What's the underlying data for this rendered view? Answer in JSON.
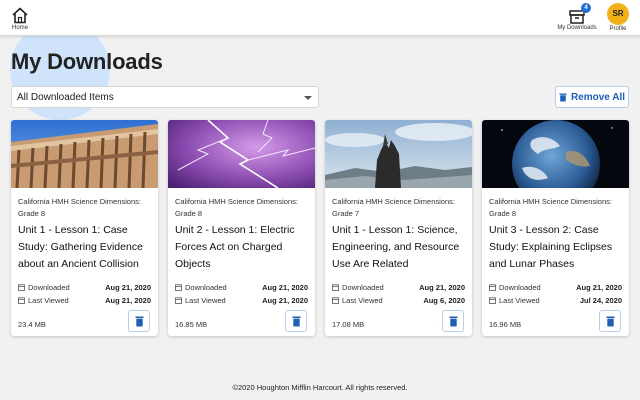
{
  "header": {
    "home_label": "Home",
    "downloads_label": "My Downloads",
    "downloads_badge": "4",
    "profile_initials": "SR",
    "profile_label": "Profile"
  },
  "page": {
    "title": "My Downloads",
    "filter_value": "All Downloaded Items",
    "remove_all_label": "Remove All"
  },
  "labels": {
    "downloaded": "Downloaded",
    "last_viewed": "Last Viewed"
  },
  "cards": [
    {
      "series": "California HMH Science Dimensions: Grade 8",
      "title": "Unit 1 - Lesson 1: Case Study: Gathering Evidence about an Ancient Collision",
      "downloaded": "Aug 21, 2020",
      "last_viewed": "Aug 21, 2020",
      "size": "23.4 MB"
    },
    {
      "series": "California HMH Science Dimensions: Grade 8",
      "title": "Unit 2 - Lesson 1: Electric Forces Act on Charged Objects",
      "downloaded": "Aug 21, 2020",
      "last_viewed": "Aug 21, 2020",
      "size": "16.85 MB"
    },
    {
      "series": "California HMH Science Dimensions: Grade 7",
      "title": "Unit 1 - Lesson 1: Science, Engineering, and Resource Use Are Related",
      "downloaded": "Aug 21, 2020",
      "last_viewed": "Aug 6, 2020",
      "size": "17.08 MB"
    },
    {
      "series": "California HMH Science Dimensions: Grade 8",
      "title": "Unit 3 - Lesson 2: Case Study: Explaining Eclipses and Lunar Phases",
      "downloaded": "Aug 21, 2020",
      "last_viewed": "Jul 24, 2020",
      "size": "16.96 MB"
    }
  ],
  "footer": {
    "copyright": "©2020 Houghton Mifflin Harcourt. All rights reserved."
  },
  "colors": {
    "accent": "#1f6fd6",
    "avatar": "#f2b11b",
    "halo": "#cfe4fb"
  },
  "icons": {
    "home": "home-icon",
    "downloads": "downloads-box-icon",
    "trash": "trash-icon",
    "downloaded_meta": "download-meta-icon",
    "last_viewed_meta": "calendar-icon",
    "dropdown": "chevron-down-icon"
  }
}
